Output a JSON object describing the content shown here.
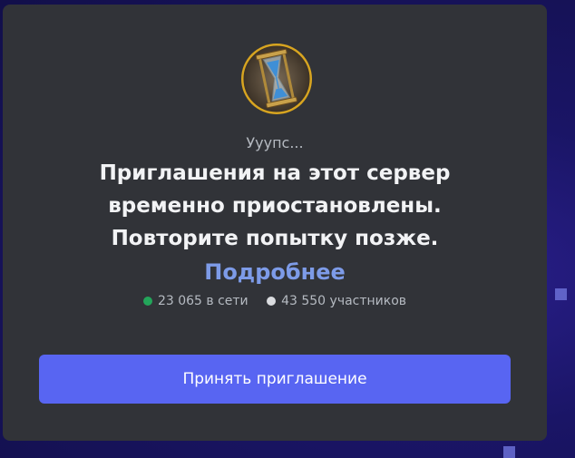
{
  "invite": {
    "pretitle": "Ууупс...",
    "title_lines": [
      "Приглашения на этот сервер",
      "временно приостановлены.",
      "Повторите попытку позже."
    ],
    "learn_more": "Подробнее",
    "online_count": "23 065 в сети",
    "member_count": "43 550 участников",
    "accept_button": "Принять приглашение",
    "server_icon": "hourglass-icon"
  },
  "colors": {
    "card": "#313338",
    "accent": "#5865f2",
    "link": "#7d9be8",
    "online": "#23a55a",
    "background": "#1a1566"
  }
}
